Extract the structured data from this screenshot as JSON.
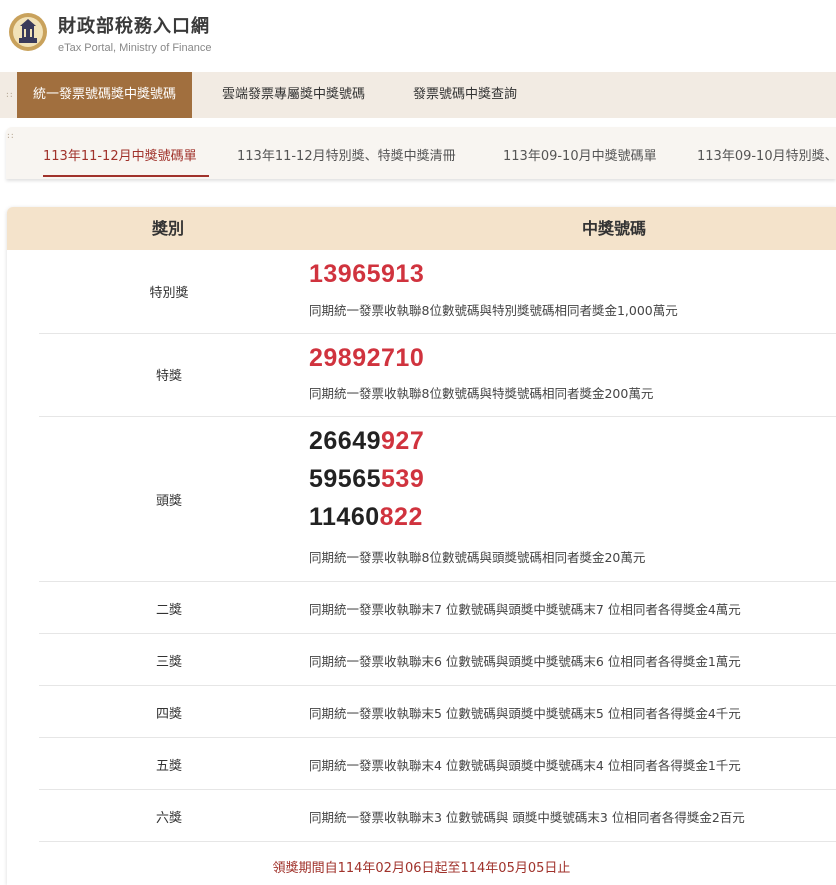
{
  "header": {
    "title": "財政部稅務入口網",
    "subtitle": "eTax Portal, Ministry of Finance",
    "logo_icon": "taiwan-emblem-icon"
  },
  "main_nav": {
    "tabs": [
      {
        "label": "統一發票號碼獎中獎號碼",
        "active": true
      },
      {
        "label": "雲端發票專屬獎中獎號碼",
        "active": false
      },
      {
        "label": "發票號碼中獎查詢",
        "active": false
      }
    ]
  },
  "sub_nav": {
    "tabs": [
      {
        "label": "113年11-12月中獎號碼單",
        "active": true
      },
      {
        "label": "113年11-12月特別獎、特獎中獎清冊",
        "active": false
      },
      {
        "label": "113年09-10月中獎號碼單",
        "active": false
      },
      {
        "label": "113年09-10月特別獎、",
        "active": false
      }
    ]
  },
  "table": {
    "headers": {
      "prize": "獎別",
      "numbers": "中獎號碼"
    },
    "rows": [
      {
        "prize": "特別獎",
        "numbers": [
          {
            "prefix": "",
            "suffix": "13965913"
          }
        ],
        "desc": "同期統一發票收執聯8位數號碼與特別獎號碼相同者獎金1,000萬元"
      },
      {
        "prize": "特獎",
        "numbers": [
          {
            "prefix": "",
            "suffix": "29892710"
          }
        ],
        "desc": "同期統一發票收執聯8位數號碼與特獎號碼相同者獎金200萬元"
      },
      {
        "prize": "頭獎",
        "numbers": [
          {
            "prefix": "26649",
            "suffix": "927"
          },
          {
            "prefix": "59565",
            "suffix": "539"
          },
          {
            "prefix": "11460",
            "suffix": "822"
          }
        ],
        "desc": "同期統一發票收執聯8位數號碼與頭獎號碼相同者獎金20萬元"
      },
      {
        "prize": "二獎",
        "desc": "同期統一發票收執聯末7 位數號碼與頭獎中獎號碼末7 位相同者各得獎金4萬元"
      },
      {
        "prize": "三獎",
        "desc": "同期統一發票收執聯末6 位數號碼與頭獎中獎號碼末6 位相同者各得獎金1萬元"
      },
      {
        "prize": "四獎",
        "desc": "同期統一發票收執聯末5 位數號碼與頭獎中獎號碼末5 位相同者各得獎金4千元"
      },
      {
        "prize": "五獎",
        "desc": "同期統一發票收執聯末4 位數號碼與頭獎中獎號碼末4 位相同者各得獎金1千元"
      },
      {
        "prize": "六獎",
        "desc": "同期統一發票收執聯末3 位數號碼與 頭獎中獎號碼末3 位相同者各得獎金2百元"
      }
    ],
    "footer": "領獎期間自114年02月06日起至114年05月05日止"
  },
  "colors": {
    "accent_brown": "#a16f3e",
    "number_red": "#d0333e",
    "header_tan": "#f4e3cb",
    "nav_bg": "#f2ebe3"
  }
}
